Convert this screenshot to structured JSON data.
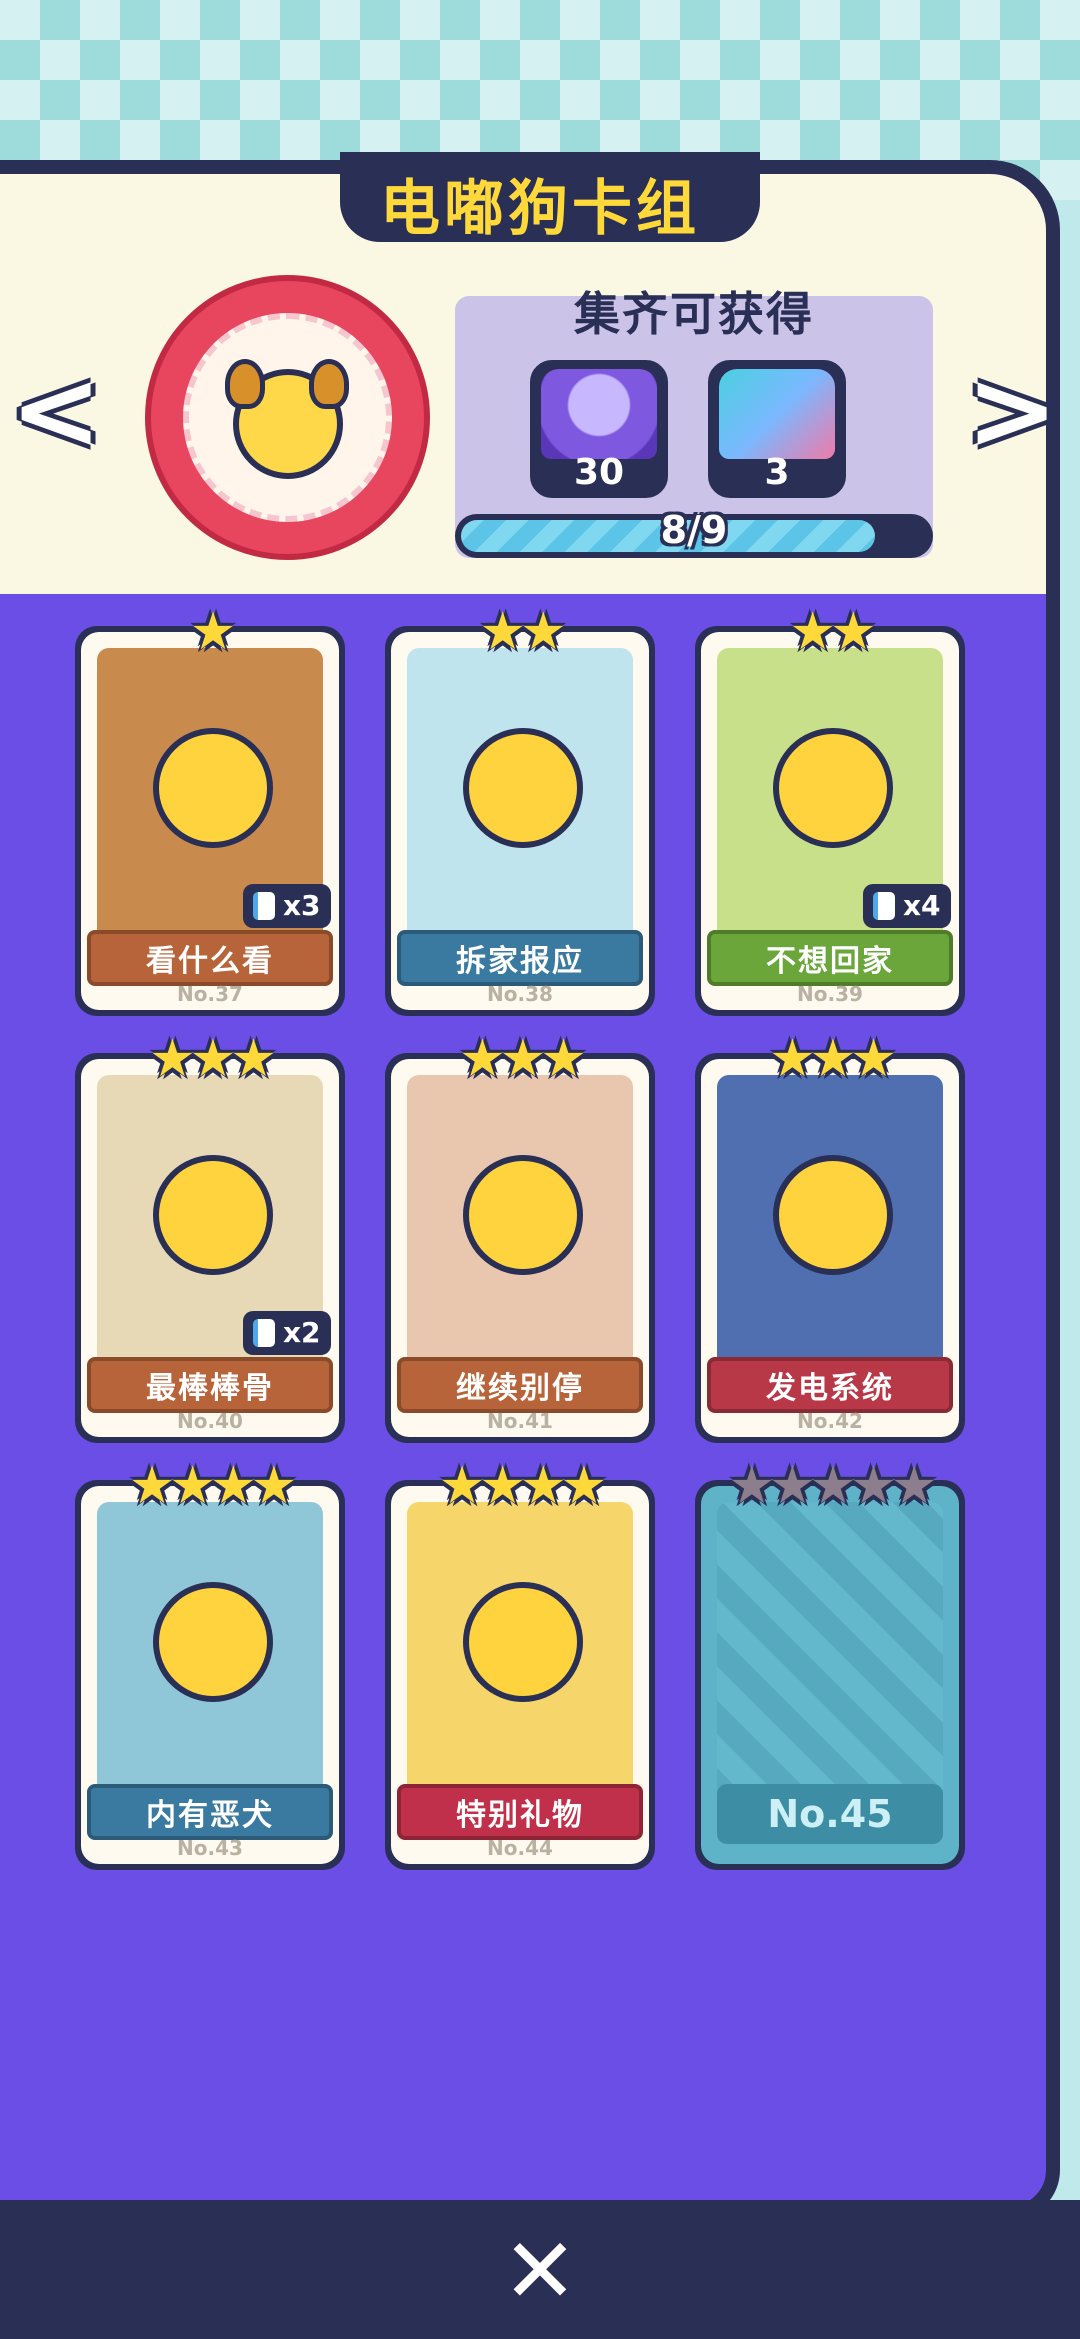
{
  "title": "电嘟狗卡组",
  "nav": {
    "prev_icon": "<",
    "next_icon": ">"
  },
  "reward": {
    "title": "集齐可获得",
    "items": [
      {
        "icon": "capsule-icon",
        "count": "30"
      },
      {
        "icon": "card-pack-icon",
        "count": "3"
      }
    ],
    "progress_text": "8/9",
    "progress_fraction": 0.889
  },
  "cards": [
    {
      "name": "看什么看",
      "no": "No.37",
      "stars": "★",
      "count": "x3",
      "ribbon_color": "#b8643a",
      "art_color": "#c98a4e"
    },
    {
      "name": "拆家报应",
      "no": "No.38",
      "stars": "★★",
      "count": "",
      "ribbon_color": "#3a7aa0",
      "art_color": "#bfe4ee"
    },
    {
      "name": "不想回家",
      "no": "No.39",
      "stars": "★★",
      "count": "x4",
      "ribbon_color": "#6aa63a",
      "art_color": "#c9e08a"
    },
    {
      "name": "最棒棒骨",
      "no": "No.40",
      "stars": "★★★",
      "count": "x2",
      "ribbon_color": "#b8643a",
      "art_color": "#e8d9b6"
    },
    {
      "name": "继续别停",
      "no": "No.41",
      "stars": "★★★",
      "count": "",
      "ribbon_color": "#b8643a",
      "art_color": "#e9c7ae"
    },
    {
      "name": "发电系统",
      "no": "No.42",
      "stars": "★★★",
      "count": "",
      "ribbon_color": "#b83848",
      "art_color": "#4f6fb0"
    },
    {
      "name": "内有恶犬",
      "no": "No.43",
      "stars": "★★★★",
      "count": "",
      "ribbon_color": "#3a7aa0",
      "art_color": "#8fc6d8"
    },
    {
      "name": "特别礼物",
      "no": "No.44",
      "stars": "★★★★",
      "count": "",
      "ribbon_color": "#c0304a",
      "art_color": "#f6d56a"
    },
    {
      "name": "",
      "no": "No.45",
      "stars": "★★★★★",
      "count": "",
      "locked": true
    }
  ],
  "close_icon": "✕"
}
